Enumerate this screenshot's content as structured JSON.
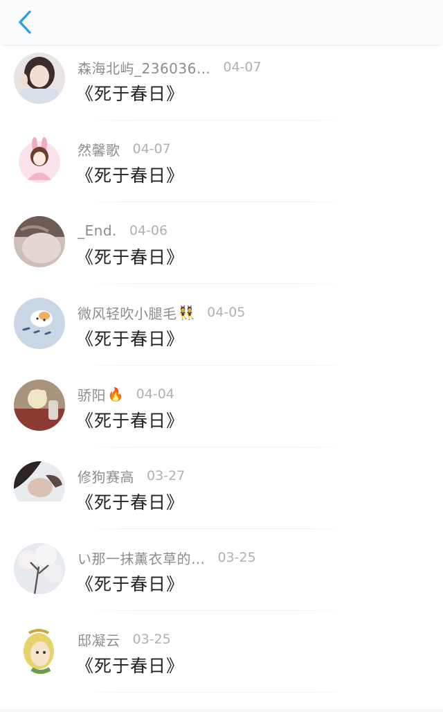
{
  "header": {
    "back_icon": "chevron-left-icon",
    "accent_color": "#2a9de8"
  },
  "comments": [
    {
      "name": "森海北屿_236036…",
      "date": "04-07",
      "text": "《死于春日》"
    },
    {
      "name": "然馨歌",
      "date": "04-07",
      "text": "《死于春日》"
    },
    {
      "name": "_End.",
      "date": "04-06",
      "text": "《死于春日》"
    },
    {
      "name": "微风轻吹小腿毛",
      "emoji": "👯",
      "date": "04-05",
      "text": "《死于春日》"
    },
    {
      "name": "骄阳",
      "emoji": "🔥",
      "date": "04-04",
      "text": "《死于春日》"
    },
    {
      "name": "修狗赛高",
      "date": "03-27",
      "text": "《死于春日》"
    },
    {
      "name": "い那一抹薰衣草的…",
      "date": "03-25",
      "text": "《死于春日》"
    },
    {
      "name": "邸凝云",
      "date": "03-25",
      "text": "《死于春日》"
    }
  ]
}
